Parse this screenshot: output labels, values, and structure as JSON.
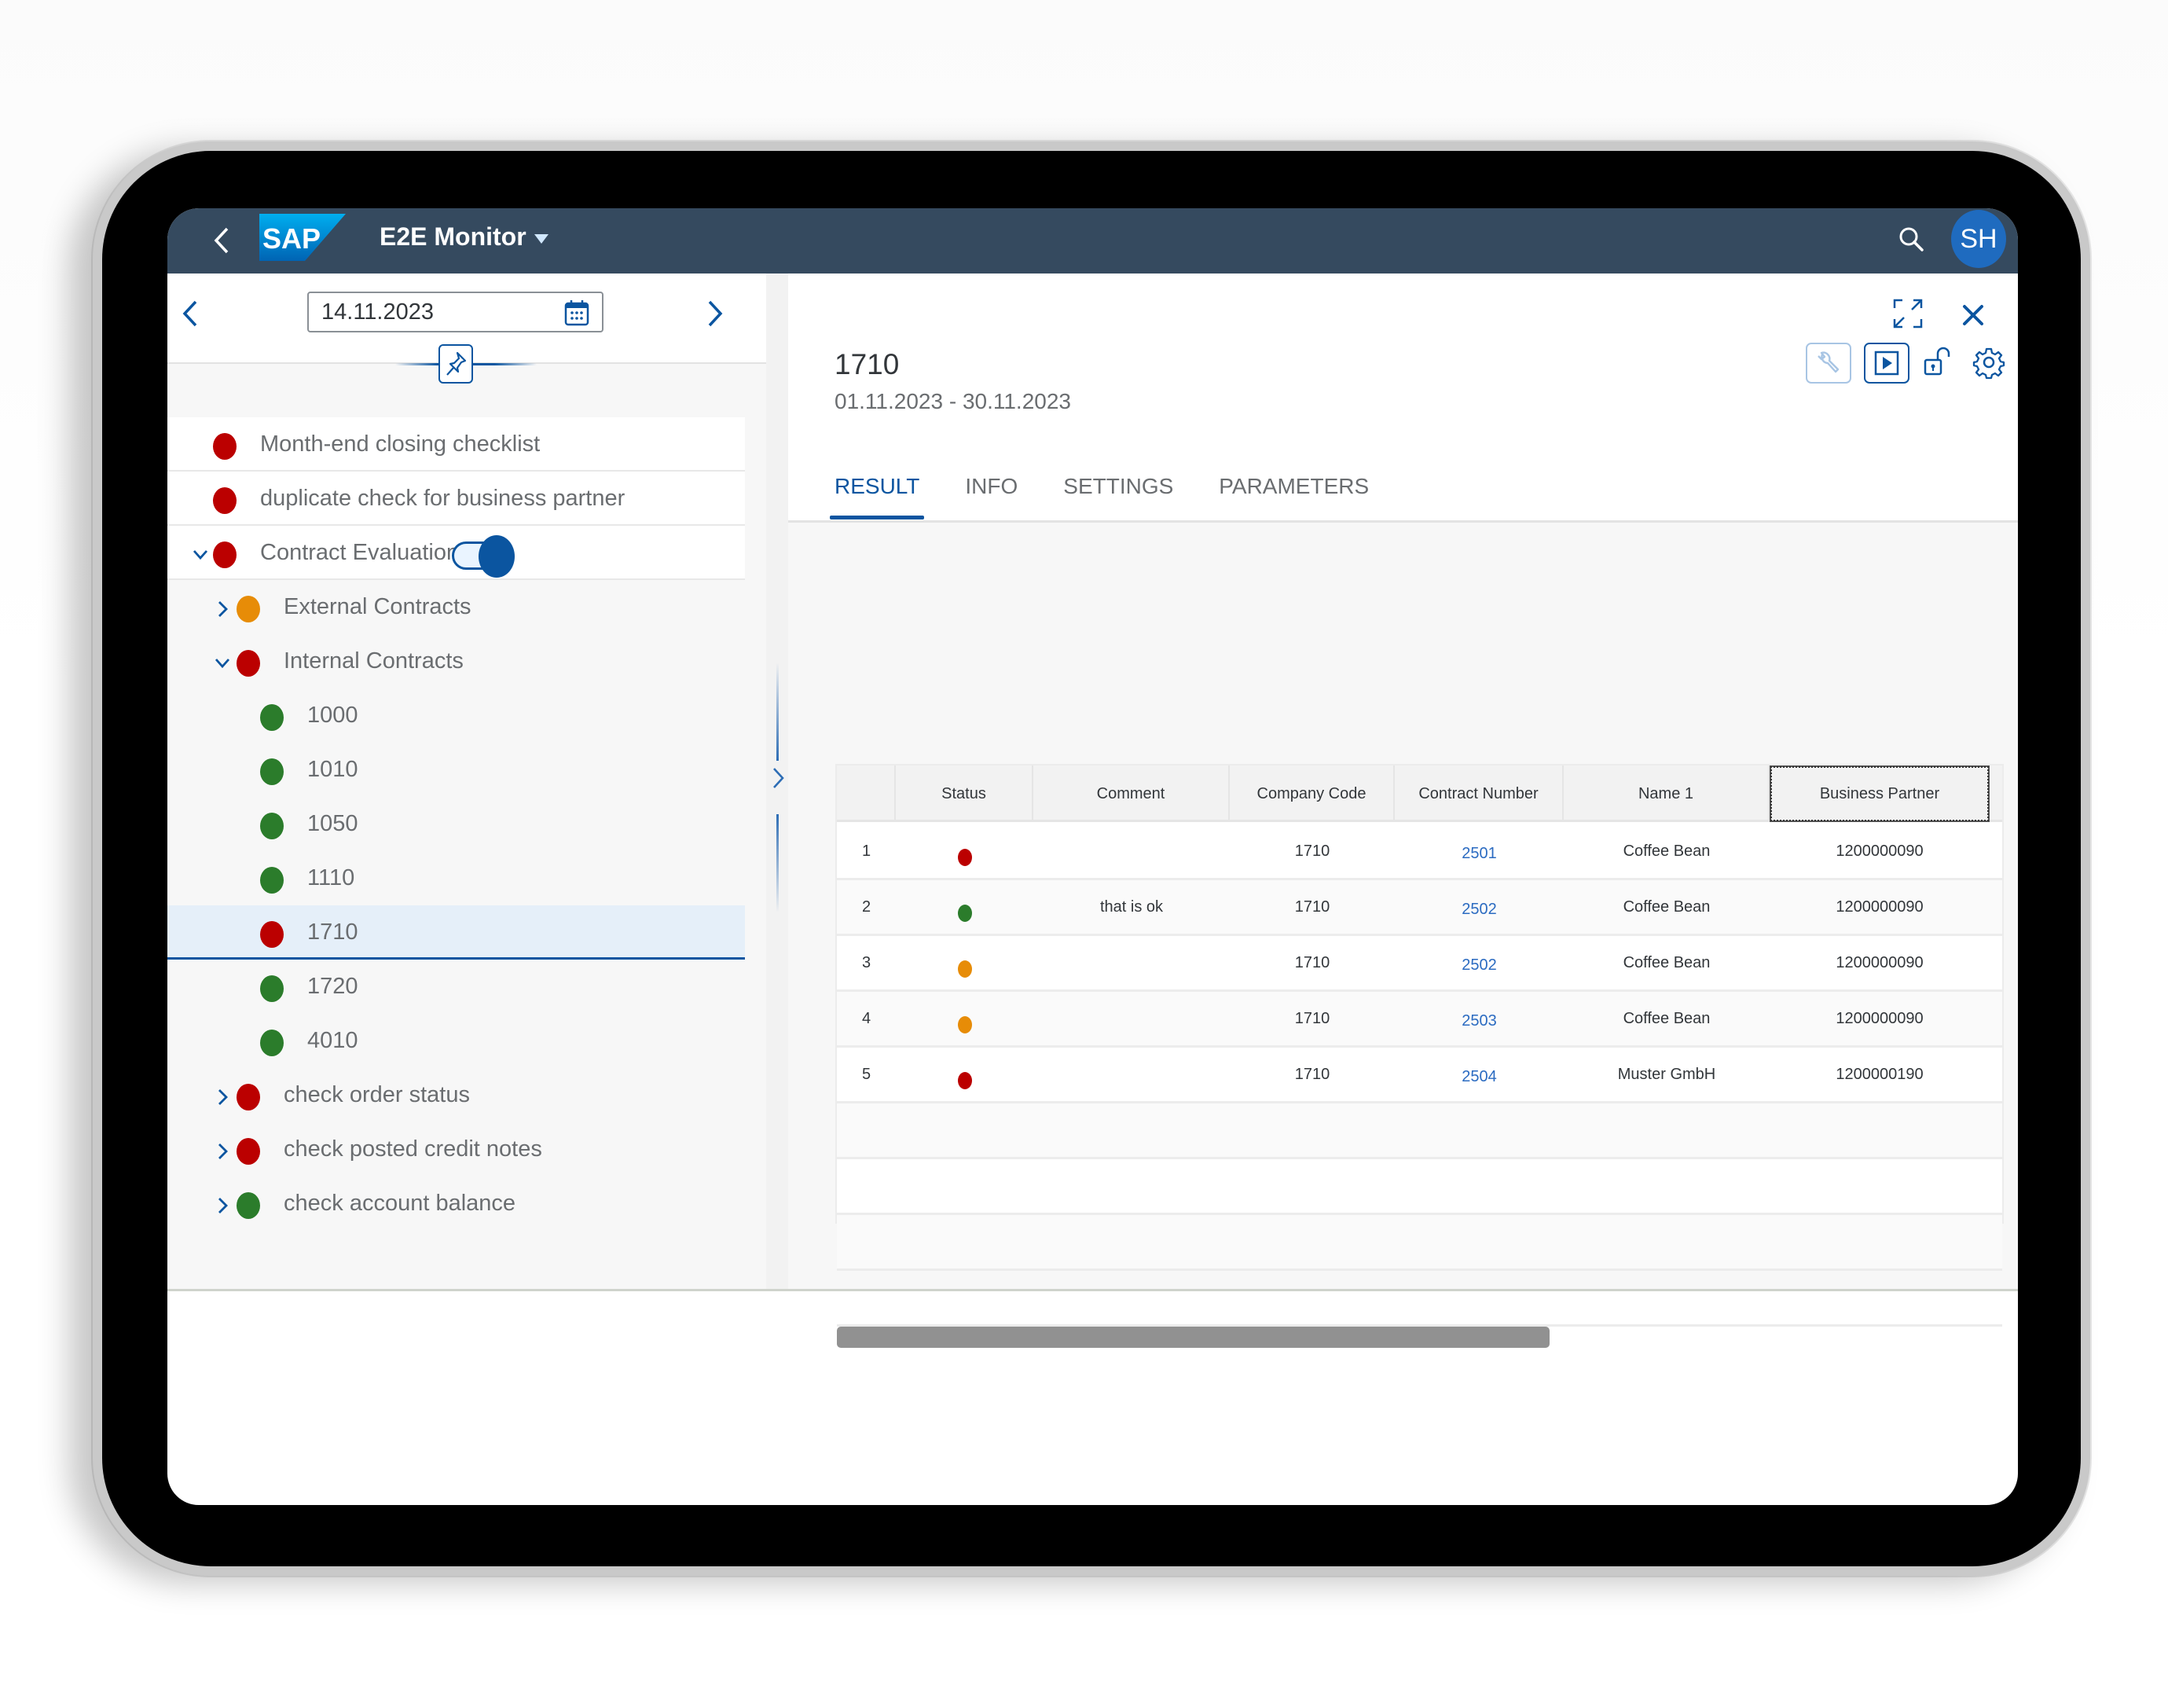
{
  "shell": {
    "back_icon": "chevron-left-icon",
    "logo_text": "SAP",
    "app_title": "E2E Monitor",
    "search_icon": "search-icon",
    "avatar_initials": "SH"
  },
  "colors": {
    "shell_bg": "#354a5f",
    "accent": "#0b55a0",
    "status_red": "#bb0000",
    "status_green": "#2b7c2b",
    "status_orange": "#e78c07",
    "link": "#2b6bc1"
  },
  "left_panel": {
    "date_value": "14.11.2023",
    "prev_icon": "chevron-left-icon",
    "next_icon": "chevron-right-icon",
    "calendar_icon": "calendar-icon",
    "pin_icon": "pin-icon",
    "tree": [
      {
        "label": "Month-end closing checklist",
        "status": "red",
        "level": 0,
        "expander": "none"
      },
      {
        "label": "duplicate check for business partner",
        "status": "red",
        "level": 0,
        "expander": "none"
      },
      {
        "label": "Contract Evaluation",
        "status": "red",
        "level": 0,
        "expander": "expanded",
        "toggle_on": true
      },
      {
        "label": "External Contracts",
        "status": "orange",
        "level": 1,
        "expander": "collapsed"
      },
      {
        "label": "Internal Contracts",
        "status": "red",
        "level": 1,
        "expander": "expanded"
      },
      {
        "label": "1000",
        "status": "green",
        "level": 2,
        "expander": "none"
      },
      {
        "label": "1010",
        "status": "green",
        "level": 2,
        "expander": "none"
      },
      {
        "label": "1050",
        "status": "green",
        "level": 2,
        "expander": "none"
      },
      {
        "label": "1110",
        "status": "green",
        "level": 2,
        "expander": "none"
      },
      {
        "label": "1710",
        "status": "red",
        "level": 2,
        "expander": "none",
        "selected": true
      },
      {
        "label": "1720",
        "status": "green",
        "level": 2,
        "expander": "none"
      },
      {
        "label": "4010",
        "status": "green",
        "level": 2,
        "expander": "none"
      },
      {
        "label": "check order status",
        "status": "red",
        "level": 1,
        "expander": "collapsed"
      },
      {
        "label": "check posted credit notes",
        "status": "red",
        "level": 1,
        "expander": "collapsed"
      },
      {
        "label": "check account balance",
        "status": "green",
        "level": 1,
        "expander": "collapsed"
      }
    ]
  },
  "right_panel": {
    "title": "1710",
    "subtitle": "01.11.2023 - 30.11.2023",
    "actions": {
      "fullscreen_icon": "fullscreen-icon",
      "close_icon": "close-icon",
      "wrench_icon": "wrench-icon",
      "run_icon": "play-icon",
      "unlock_icon": "unlock-icon",
      "settings_icon": "gear-icon"
    },
    "tabs": [
      {
        "label": "RESULT",
        "active": true
      },
      {
        "label": "INFO",
        "active": false
      },
      {
        "label": "SETTINGS",
        "active": false
      },
      {
        "label": "PARAMETERS",
        "active": false
      }
    ],
    "edit_icon": "edit-document-icon",
    "table": {
      "columns": [
        "",
        "Status",
        "Comment",
        "Company Code",
        "Contract Number",
        "Name 1",
        "Business Partner"
      ],
      "rows": [
        {
          "index": "1",
          "status": "red",
          "comment": "",
          "company_code": "1710",
          "contract_number": "2501",
          "name1": "Coffee Bean",
          "business_partner": "1200000090"
        },
        {
          "index": "2",
          "status": "green",
          "comment": "that is ok",
          "company_code": "1710",
          "contract_number": "2502",
          "name1": "Coffee Bean",
          "business_partner": "1200000090"
        },
        {
          "index": "3",
          "status": "orange",
          "comment": "",
          "company_code": "1710",
          "contract_number": "2502",
          "name1": "Coffee Bean",
          "business_partner": "1200000090"
        },
        {
          "index": "4",
          "status": "orange",
          "comment": "",
          "company_code": "1710",
          "contract_number": "2503",
          "name1": "Coffee Bean",
          "business_partner": "1200000090"
        },
        {
          "index": "5",
          "status": "red",
          "comment": "",
          "company_code": "1710",
          "contract_number": "2504",
          "name1": "Muster GmbH",
          "business_partner": "1200000190"
        }
      ],
      "empty_rows": 4,
      "horizontal_scroll_visible_fraction": 0.61
    }
  }
}
